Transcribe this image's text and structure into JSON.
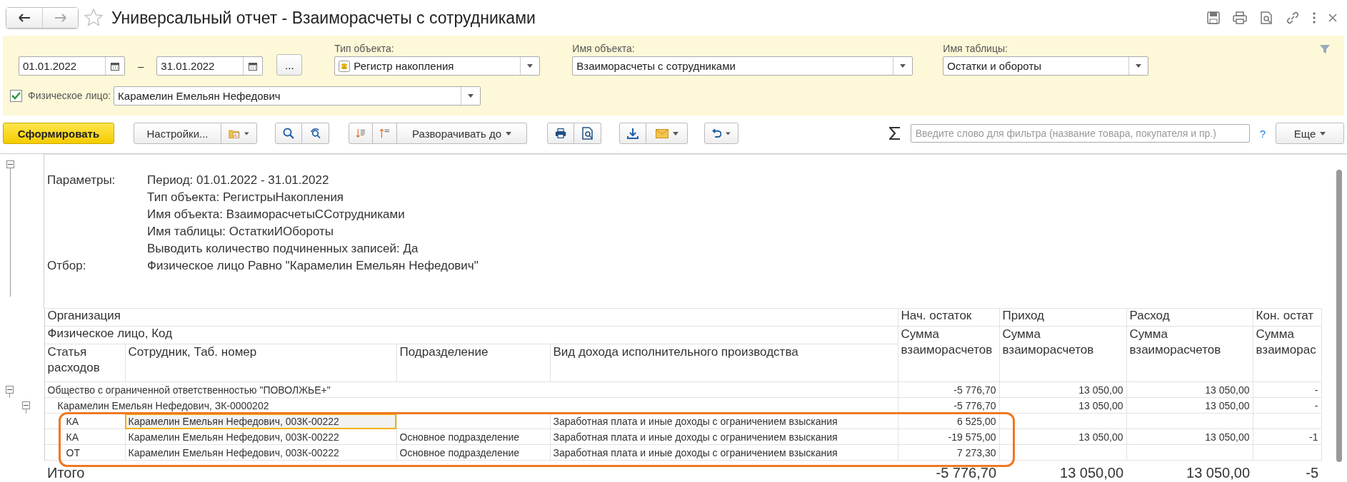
{
  "window": {
    "title": "Универсальный отчет - Взаиморасчеты с сотрудниками",
    "favorite": false
  },
  "filters": {
    "period_start": "01.01.2022",
    "period_separator": "–",
    "period_end": "31.01.2022",
    "period_button": "...",
    "fields": [
      {
        "label": "Тип объекта:",
        "value": "Регистр накопления",
        "kind": "register"
      },
      {
        "label": "Имя объекта:",
        "value": "Взаиморасчеты с сотрудниками",
        "kind": "plain"
      },
      {
        "label": "Имя таблицы:",
        "value": "Остатки и обороты",
        "kind": "plain"
      }
    ],
    "person_filter": {
      "checked": true,
      "label": "Физическое лицо:",
      "value": "Карамелин Емельян Нефедович"
    }
  },
  "toolbar": {
    "generate": "Сформировать",
    "settings": "Настройки...",
    "expand": "Разворачивать до",
    "search_placeholder": "Введите слово для фильтра (название товара, покупателя и пр.)",
    "help": "?",
    "more": "Еще"
  },
  "report": {
    "parameters": [
      {
        "label": "Параметры:",
        "lines": [
          "Период: 01.01.2022 - 31.01.2022",
          "Тип объекта: РегистрыНакопления",
          "Имя объекта: ВзаиморасчетыССотрудниками",
          "Имя таблицы: ОстаткиИОбороты",
          "Выводить количество подчиненных записей: Да"
        ]
      },
      {
        "label": "Отбор:",
        "lines": [
          "Физическое лицо Равно \"Карамелин Емельян Нефедович\""
        ]
      }
    ],
    "grouping_headers": [
      "Организация",
      "Физическое лицо, Код"
    ],
    "columns": [
      "Статья расходов",
      "Сотрудник, Таб. номер",
      "Подразделение",
      "Вид дохода исполнительного производства"
    ],
    "measures": [
      {
        "group": "Нач. остаток",
        "title": "Сумма взаиморасчетов"
      },
      {
        "group": "Приход",
        "title": "Сумма взаиморасчетов"
      },
      {
        "group": "Расход",
        "title": "Сумма взаиморасчетов"
      },
      {
        "group": "Кон. остат",
        "title": "Сумма взаиморас"
      }
    ],
    "groups": [
      {
        "label": "Общество с ограниченной ответственностью \"ПОВОЛЖЬЕ+\"",
        "expanded": true,
        "values": [
          "-5 776,70",
          "13 050,00",
          "13 050,00",
          "-"
        ],
        "children": [
          {
            "label": "Карамелин Емельян Нефедович, ЗК-0000202",
            "expanded": true,
            "values": [
              "-5 776,70",
              "13 050,00",
              "13 050,00",
              "-"
            ],
            "rows": [
              {
                "highlighted": true,
                "cells": [
                  {
                    "text": "КА",
                    "selected": false
                  },
                  {
                    "text": "Карамелин Емельян Нефедович, 003К-00222",
                    "selected": true
                  },
                  {
                    "selected": false
                  },
                  {
                    "text": "Заработная плата и иные доходы с ограничением взыскания",
                    "selected": false
                  }
                ],
                "values": [
                  "6 525,00"
                ]
              },
              {
                "highlighted": true,
                "cells": [
                  {
                    "text": "КА",
                    "selected": false
                  },
                  {
                    "text": "Карамелин Емельян Нефедович, 003К-00222",
                    "selected": false
                  },
                  {
                    "text": "Основное подразделение",
                    "selected": false
                  },
                  {
                    "text": "Заработная плата и иные доходы с ограничением взыскания",
                    "selected": false
                  }
                ],
                "values": [
                  "-19 575,00",
                  "13 050,00",
                  "13 050,00",
                  "-1"
                ]
              },
              {
                "highlighted": true,
                "cells": [
                  {
                    "text": "ОТ",
                    "selected": false
                  },
                  {
                    "text": "Карамелин Емельян Нефедович, 003К-00222",
                    "selected": false
                  },
                  {
                    "text": "Основное подразделение",
                    "selected": false
                  },
                  {
                    "text": "Заработная плата и иные доходы с ограничением взыскания",
                    "selected": false
                  }
                ],
                "values": [
                  "7 273,30"
                ]
              }
            ]
          }
        ]
      }
    ],
    "total": {
      "label": "Итого",
      "values": [
        "-5 776,70",
        "13 050,00",
        "13 050,00",
        "-5"
      ]
    }
  }
}
